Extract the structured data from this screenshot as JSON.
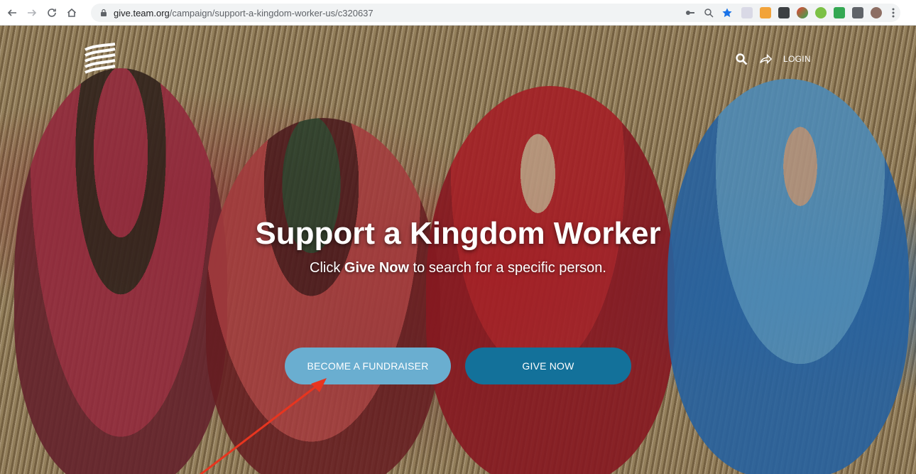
{
  "browser": {
    "url_host": "give.team.org",
    "url_path": "/campaign/support-a-kingdom-worker-us/c320637"
  },
  "header": {
    "login_label": "LOGIN"
  },
  "hero": {
    "title": "Support a Kingdom Worker",
    "subtitle_pre": "Click ",
    "subtitle_bold": "Give Now",
    "subtitle_post": " to search for a specific person."
  },
  "actions": {
    "fundraiser_label": "BECOME A FUNDRAISER",
    "give_label": "GIVE NOW"
  },
  "colors": {
    "fundraiser_button": "#6aaed0",
    "give_button": "#13719a",
    "annotation_arrow": "#e8351f"
  }
}
